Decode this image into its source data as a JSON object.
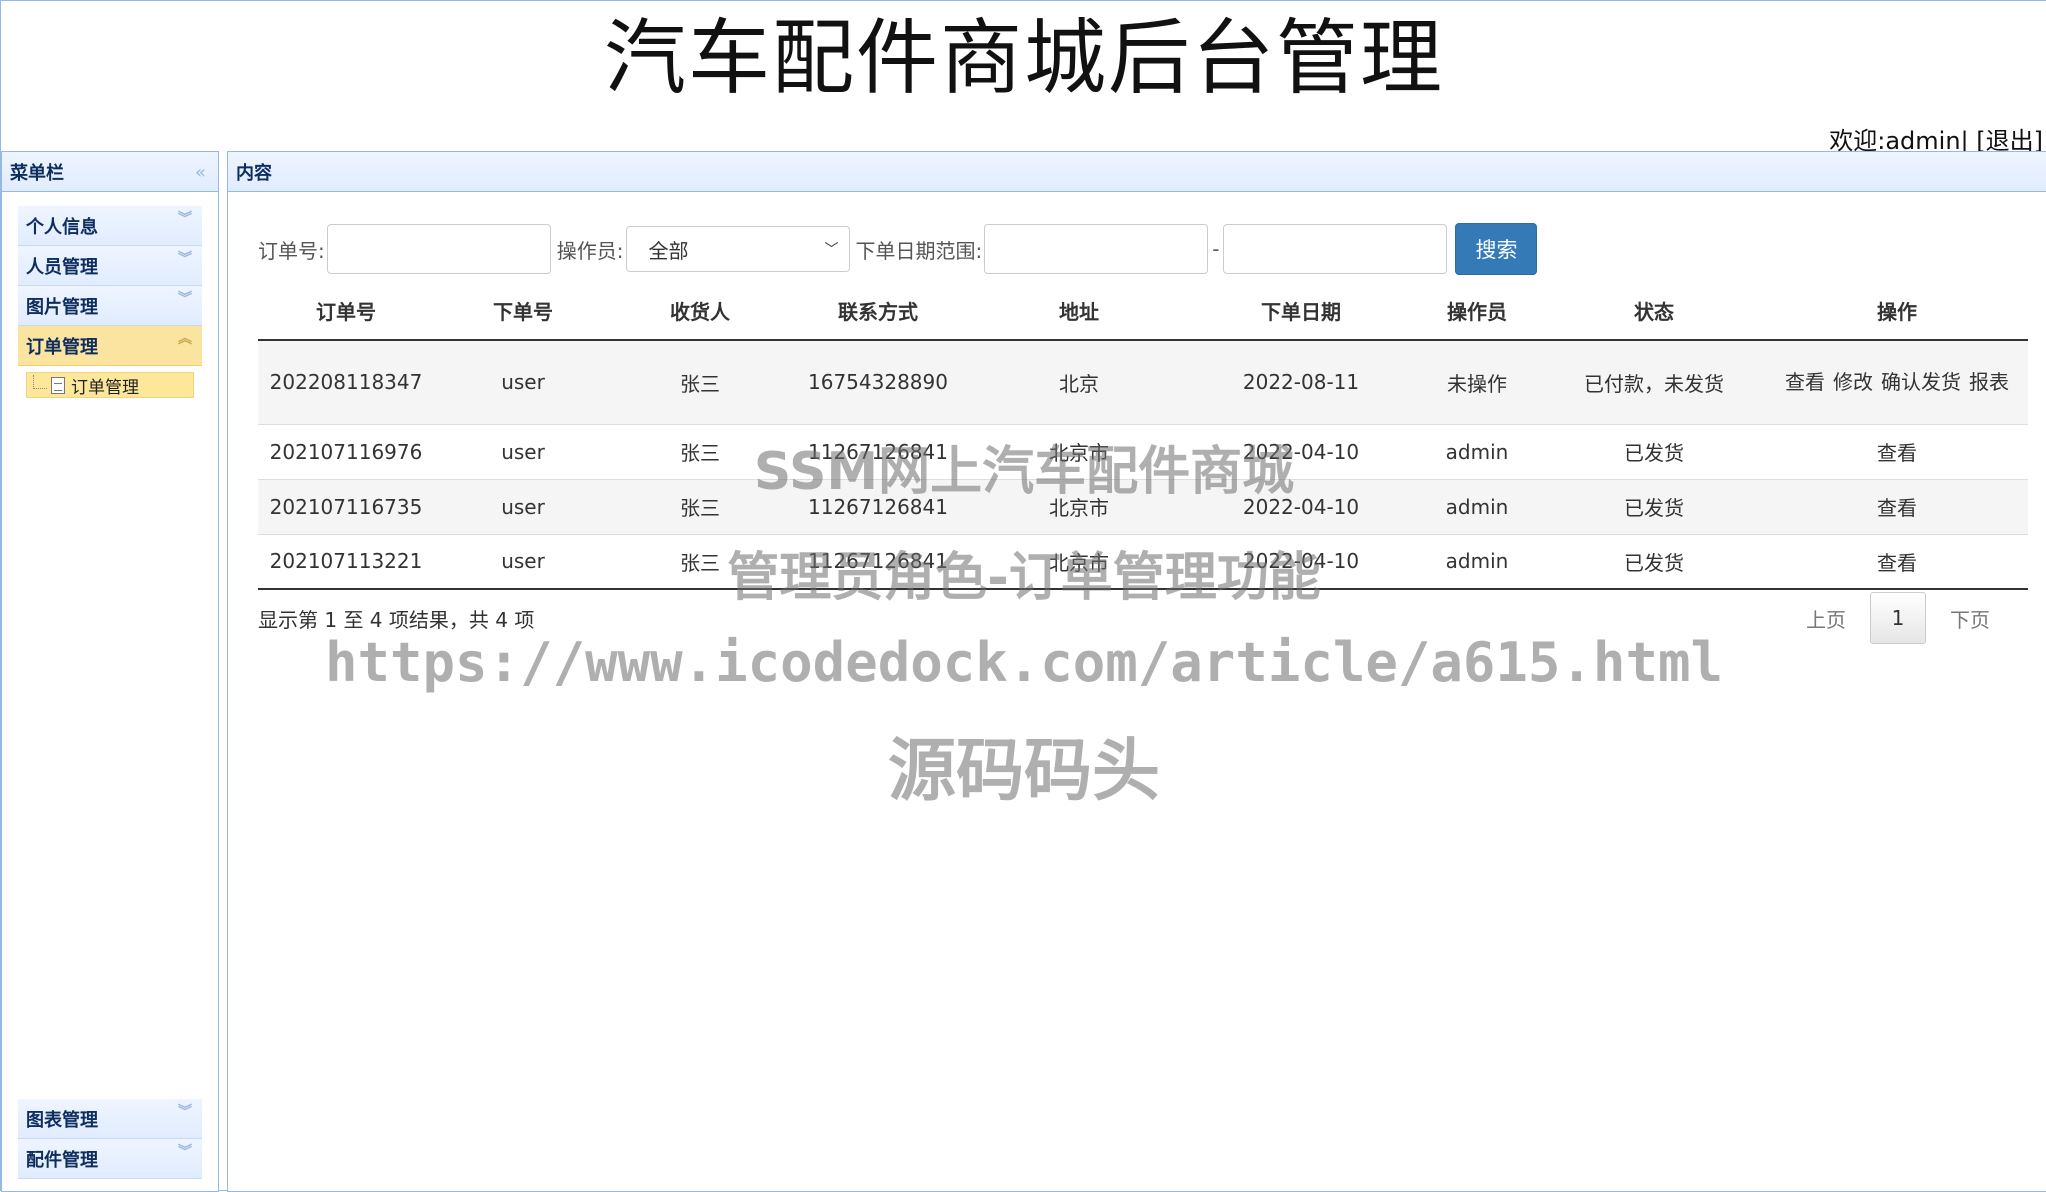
{
  "header": {
    "site_title": "汽车配件商城后台管理",
    "welcome": "欢迎:admin|",
    "logout": "[退出]"
  },
  "sidebar": {
    "title": "菜单栏",
    "collapse_icon": "«",
    "groups": [
      {
        "label": "个人信息"
      },
      {
        "label": "人员管理"
      },
      {
        "label": "图片管理"
      },
      {
        "label": "订单管理"
      }
    ],
    "active_submenu": "订单管理",
    "bottom_groups": [
      {
        "label": "图表管理"
      },
      {
        "label": "配件管理"
      }
    ]
  },
  "content": {
    "title": "内容",
    "search": {
      "order_no_label": "订单号:",
      "order_no_value": "",
      "operator_label": "操作员:",
      "operator_selected": "全部",
      "date_range_label": "下单日期范围:",
      "date_from": "",
      "date_sep": "-",
      "date_to": "",
      "search_button": "搜索"
    },
    "table": {
      "columns": [
        "订单号",
        "下单号",
        "收货人",
        "联系方式",
        "地址",
        "下单日期",
        "操作员",
        "状态",
        "操作"
      ],
      "rows": [
        {
          "order_no": "202208118347",
          "placer": "user",
          "receiver": "张三",
          "phone": "16754328890",
          "address": "北京",
          "date": "2022-08-11",
          "operator": "未操作",
          "status": "已付款，未发货",
          "actions": [
            "查看",
            "修改",
            "确认发货",
            "报表"
          ]
        },
        {
          "order_no": "202107116976",
          "placer": "user",
          "receiver": "张三",
          "phone": "11267126841",
          "address": "北京市",
          "date": "2022-04-10",
          "operator": "admin",
          "status": "已发货",
          "actions": [
            "查看"
          ]
        },
        {
          "order_no": "202107116735",
          "placer": "user",
          "receiver": "张三",
          "phone": "11267126841",
          "address": "北京市",
          "date": "2022-04-10",
          "operator": "admin",
          "status": "已发货",
          "actions": [
            "查看"
          ]
        },
        {
          "order_no": "202107113221",
          "placer": "user",
          "receiver": "张三",
          "phone": "11267126841",
          "address": "北京市",
          "date": "2022-04-10",
          "operator": "admin",
          "status": "已发货",
          "actions": [
            "查看"
          ]
        }
      ]
    },
    "pagination": {
      "info": "显示第 1 至 4 项结果，共 4 项",
      "prev": "上页",
      "current": "1",
      "next": "下页"
    }
  },
  "watermark": {
    "line1": "SSM网上汽车配件商城",
    "line2": "管理员角色-订单管理功能",
    "line3": "https://www.icodedock.com/article/a615.html",
    "line4": "源码码头"
  }
}
